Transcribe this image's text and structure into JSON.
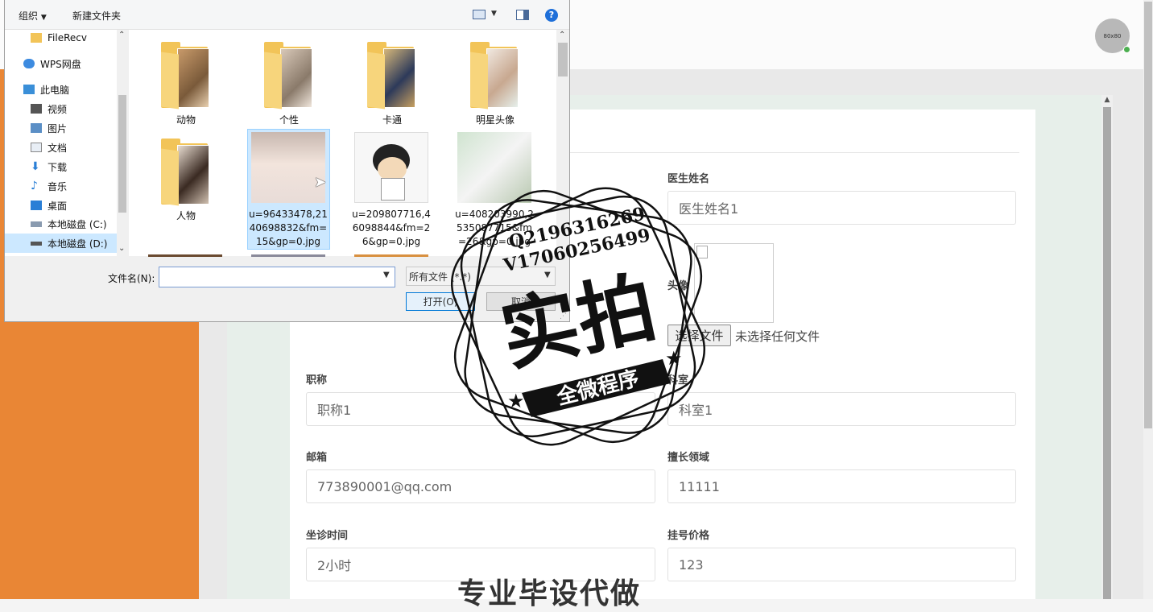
{
  "app": {
    "avatar_text": "80x80",
    "form": {
      "doctor_name": {
        "label": "医生姓名",
        "value": "医生姓名1"
      },
      "avatar": {
        "label": "头像",
        "choose_button": "选择文件",
        "no_file_text": "未选择任何文件"
      },
      "title": {
        "label": "职称",
        "value": "职称1"
      },
      "department": {
        "label": "科室",
        "value": "科室1"
      },
      "email": {
        "label": "邮箱",
        "value": "773890001@qq.com"
      },
      "specialty": {
        "label": "擅长领域",
        "value": "11111"
      },
      "consult_time": {
        "label": "坐诊时间",
        "value": "2小时"
      },
      "fee": {
        "label": "挂号价格",
        "value": "123"
      }
    }
  },
  "dialog": {
    "toolbar": {
      "organize": "组织",
      "new_folder": "新建文件夹",
      "help": "?"
    },
    "nav": [
      {
        "label": "FileRecv",
        "icon": "folder-icon"
      },
      {
        "label": "WPS网盘",
        "icon": "cloud-icon"
      },
      {
        "label": "此电脑",
        "icon": "computer-icon"
      },
      {
        "label": "视频",
        "icon": "video-icon"
      },
      {
        "label": "图片",
        "icon": "pictures-icon"
      },
      {
        "label": "文档",
        "icon": "documents-icon"
      },
      {
        "label": "下载",
        "icon": "download-icon"
      },
      {
        "label": "音乐",
        "icon": "music-icon"
      },
      {
        "label": "桌面",
        "icon": "desktop-icon"
      },
      {
        "label": "本地磁盘 (C:)",
        "icon": "drive-icon"
      },
      {
        "label": "本地磁盘 (D:)",
        "icon": "drive-icon"
      }
    ],
    "folders": [
      "动物",
      "个性",
      "卡通",
      "明星头像",
      "人物"
    ],
    "files": [
      "u=96433478,2140698832&fm=15&gp=0.jpg",
      "u=209807716,46098844&fm=26&gp=0.jpg",
      "u=408203990,2535087715&fm=26&gp=0.jpg"
    ],
    "filename_label": "文件名(N):",
    "filename_value": "",
    "filter": "所有文件 (*.*)",
    "open_button": "打开(O)",
    "cancel_button": "取消"
  },
  "watermark": {
    "contact_q": "Q2196316269",
    "contact_v": "V17060256499",
    "main": "实拍",
    "banner": "全微程序",
    "bottom": "专业毕设代做"
  },
  "colors": {
    "sidebar": "#e98635",
    "selection": "#cce8ff",
    "accent_blue": "#0078d7"
  }
}
